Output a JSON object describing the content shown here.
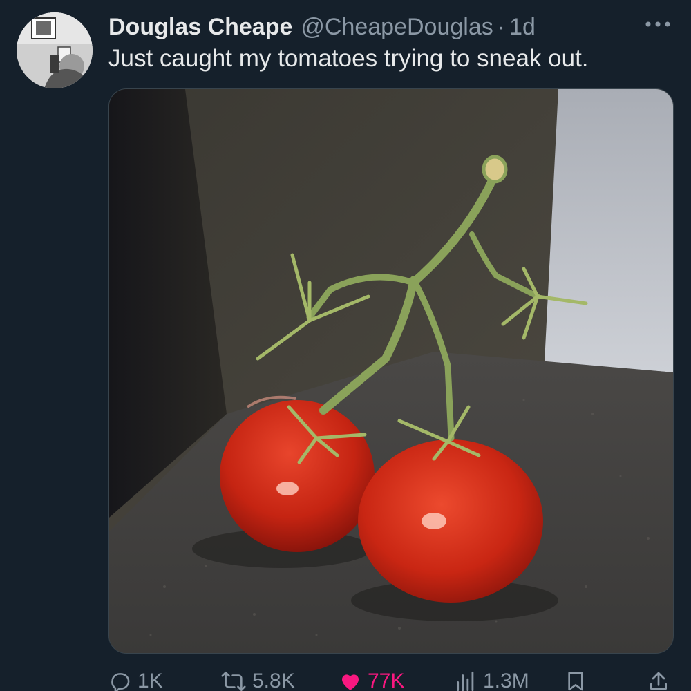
{
  "tweet": {
    "author": {
      "display_name": "Douglas Cheape",
      "handle": "@CheapeDouglas",
      "separator": "·",
      "time": "1d"
    },
    "text": "Just caught my tomatoes trying to sneak out.",
    "media": {
      "kind": "photo",
      "subject": "two tomatoes on a vine"
    },
    "actions": {
      "replies": "1K",
      "reposts": "5.8K",
      "likes": "77K",
      "views": "1.3M"
    },
    "icons": {
      "more": "more-options-icon",
      "reply": "reply-icon",
      "repost": "repost-icon",
      "like": "heart-icon",
      "views": "analytics-icon",
      "bookmark": "bookmark-icon",
      "share": "share-icon"
    },
    "colors": {
      "background": "#15202b",
      "primary_text": "#e7e9ea",
      "secondary_text": "#8b98a5",
      "like_active": "#f91880",
      "border": "#38444d"
    }
  }
}
